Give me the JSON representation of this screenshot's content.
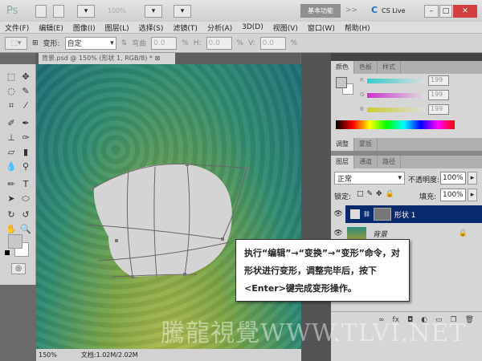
{
  "app": {
    "logo": "Ps",
    "zoom": "100%",
    "workspace": "基本功能",
    "more": ">>",
    "cslive": "CS Live"
  },
  "menu": [
    "文件(F)",
    "编辑(E)",
    "图像(I)",
    "图层(L)",
    "选择(S)",
    "滤镜(T)",
    "分析(A)",
    "3D(D)",
    "视图(V)",
    "窗口(W)",
    "帮助(H)"
  ],
  "options": {
    "warp_label": "变形:",
    "warp_value": "自定",
    "bend_label": "弯曲",
    "bend": "0.0",
    "h_label": "H:",
    "h": "0.0",
    "v_label": "V:",
    "v": "0.0",
    "pct": "%"
  },
  "document": {
    "tab": "背景.psd @ 150% (形状 1, RGB/8) *",
    "zoom": "150%",
    "doc_size": "文档:1.02M/2.02M"
  },
  "color_panel": {
    "tabs": [
      "颜色",
      "色板",
      "样式"
    ],
    "r_label": "R",
    "g_label": "G",
    "b_label": "B",
    "r": "199",
    "g": "199",
    "b": "199"
  },
  "adjust_panel": {
    "tabs": [
      "调整",
      "蒙版"
    ]
  },
  "layers_panel": {
    "tabs": [
      "图层",
      "通道",
      "路径"
    ],
    "blend_mode": "正常",
    "opacity_label": "不透明度:",
    "opacity": "100%",
    "lock_label": "锁定:",
    "fill_label": "填充:",
    "fill": "100%",
    "layers": [
      {
        "name": "形状 1",
        "selected": true
      },
      {
        "name": "背景",
        "locked": true
      }
    ]
  },
  "callout": {
    "text": "执行“编辑”→“变换”→“变形”命令，对形状进行变形，调整完毕后，按下<Enter>键完成变形操作。"
  },
  "watermark": "騰龍視覺WWW.TLVI.NET",
  "colors": {
    "selected_layer": "#0a2a6e",
    "canvas_top": "#1f6e78",
    "canvas_bottom": "#c0c050"
  }
}
